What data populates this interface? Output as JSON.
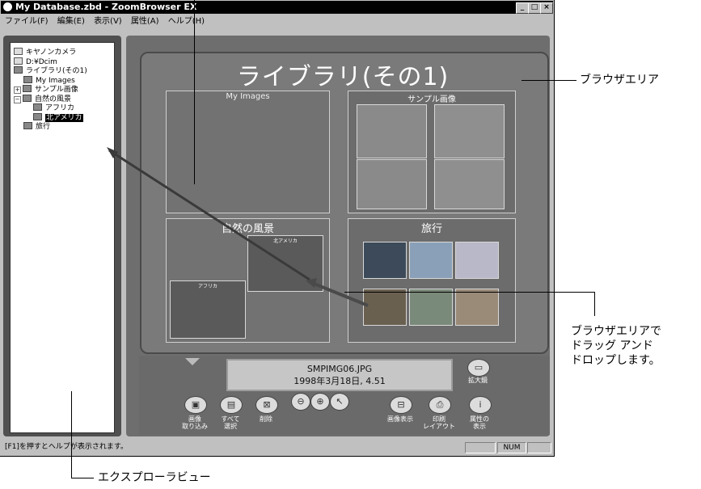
{
  "window": {
    "title": "My Database.zbd - ZoomBrowser EX",
    "controls": {
      "minimize": "_",
      "maximize": "□",
      "close": "×"
    }
  },
  "menu": {
    "items": [
      "ファイル(F)",
      "編集(E)",
      "表示(V)",
      "属性(A)",
      "ヘルプ(H)"
    ]
  },
  "tree": {
    "items": [
      {
        "label": "キヤノンカメラ",
        "icon": "camera-icon"
      },
      {
        "label": "D:¥Dcim",
        "icon": "drive-icon"
      },
      {
        "label": "ライブラリ(その1)",
        "icon": "library-icon"
      },
      {
        "label": "My Images",
        "icon": "folder-icon"
      },
      {
        "label": "サンプル画像",
        "icon": "folder-icon",
        "expander": "+"
      },
      {
        "label": "自然の風景",
        "icon": "folder-icon",
        "expander": "−"
      },
      {
        "label": "アフリカ",
        "icon": "folder-icon"
      },
      {
        "label": "北アメリカ",
        "icon": "folder-icon",
        "selected": true
      },
      {
        "label": "旅行",
        "icon": "folder-icon"
      }
    ]
  },
  "browse": {
    "title": "ライブラリ(その1)",
    "albums": [
      {
        "label": "My Images"
      },
      {
        "label": "サンプル画像"
      },
      {
        "label": "自然の風景",
        "sub": [
          "北アメリカ",
          "アフリカ"
        ]
      },
      {
        "label": "旅行"
      }
    ]
  },
  "display": {
    "line1": "SMPIMG06.JPG",
    "line2": "1998年3月18日, 4.51"
  },
  "toolbar": {
    "zoom": "拡大鏡",
    "acquire": "画像\n取り込み",
    "select_all": "すべて\n選択",
    "delete": "削除",
    "view_image": "画像表示",
    "print_layout": "印刷\nレイアウト",
    "properties": "属性の\n表示"
  },
  "status": {
    "text": "[F1]を押すとヘルプが表示されます。",
    "num": "NUM"
  },
  "callouts": {
    "browse_area": "ブラウザエリア",
    "drag_drop": "ブラウザエリアで\nドラッグ アンド\nドロップします。",
    "explorer_view": "エクスプローラビュー"
  }
}
